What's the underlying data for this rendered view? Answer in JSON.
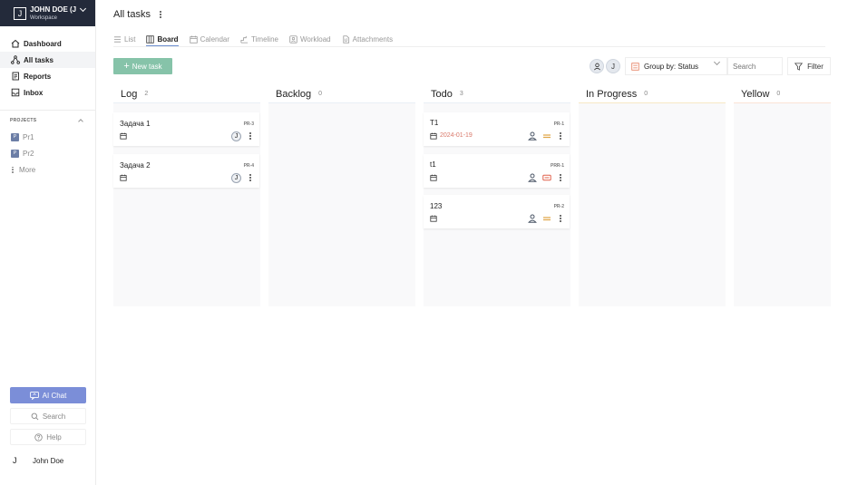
{
  "colors": {
    "accent": "#6b8ed0",
    "new_task": "#86c3a9",
    "ai_chat": "#7b8ed8",
    "date_due": "#d9786a",
    "workspace_bg": "#232a3a"
  },
  "workspace": {
    "avatar": "J",
    "name": "JOHN DOE (J",
    "subtitle": "Workspace"
  },
  "sidebar": {
    "nav": [
      {
        "label": "Dashboard",
        "icon": "home-icon"
      },
      {
        "label": "All tasks",
        "icon": "network-icon"
      },
      {
        "label": "Reports",
        "icon": "report-icon"
      },
      {
        "label": "Inbox",
        "icon": "inbox-icon"
      }
    ],
    "projects_heading": "PROJECTS",
    "projects": [
      {
        "badge": "P",
        "label": "Pr1"
      },
      {
        "badge": "P",
        "label": "Pr2"
      }
    ],
    "more_label": "More",
    "ai_chat_label": "AI Chat",
    "search_label": "Search",
    "help_label": "Help",
    "user": {
      "avatar": "J",
      "name": "John Doe"
    }
  },
  "header": {
    "title": "All tasks",
    "tabs": [
      {
        "label": "List",
        "icon": "list-icon"
      },
      {
        "label": "Board",
        "icon": "board-icon"
      },
      {
        "label": "Calendar",
        "icon": "calendar-icon"
      },
      {
        "label": "Timeline",
        "icon": "timeline-icon"
      },
      {
        "label": "Workload",
        "icon": "workload-icon"
      },
      {
        "label": "Attachments",
        "icon": "attachment-icon"
      }
    ],
    "active_tab": "Board"
  },
  "toolbar": {
    "new_task_label": "New task",
    "assignee_avatar": "J",
    "group_by_label": "Group by: Status",
    "search_placeholder": "Search",
    "filter_label": "Filter"
  },
  "board": {
    "columns": [
      {
        "title": "Log",
        "count": "2",
        "cards": [
          {
            "title": "Задача 1",
            "key": "PR-3",
            "date": "",
            "assignee": "J"
          },
          {
            "title": "Задача 2",
            "key": "PR-4",
            "date": "",
            "assignee": "J"
          }
        ]
      },
      {
        "title": "Backlog",
        "count": "0",
        "cards": []
      },
      {
        "title": "Todo",
        "count": "3",
        "cards": [
          {
            "title": "T1",
            "key": "PR-1",
            "date": "2024-01-19",
            "priority": "medium"
          },
          {
            "title": "t1",
            "key": "PRR-1",
            "date": "",
            "priority": "high"
          },
          {
            "title": "123",
            "key": "PR-2",
            "date": "",
            "priority": "medium"
          }
        ]
      },
      {
        "title": "In Progress",
        "count": "0",
        "cards": []
      },
      {
        "title": "Yellow",
        "count": "0",
        "cards": []
      }
    ]
  }
}
